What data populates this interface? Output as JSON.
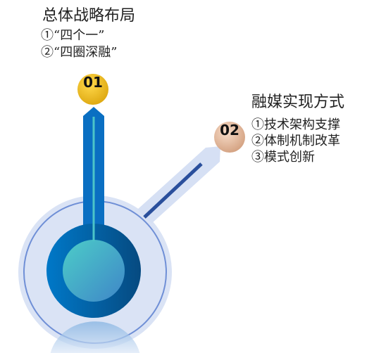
{
  "section1": {
    "badge": "01",
    "title": "总体战略布局",
    "items": [
      "①“四个一”",
      "②“四圈深融”"
    ]
  },
  "section2": {
    "badge": "02",
    "title": "融媒实现方式",
    "items": [
      "①技术架构支撑",
      "②体制机制改革",
      "③模式创新"
    ]
  },
  "colors": {
    "badge1": "#e8b400",
    "badge2": "#e9b99a",
    "bar": "#0a6fc2",
    "halo": "#d6e0f4",
    "core": "#4cc4c8"
  }
}
